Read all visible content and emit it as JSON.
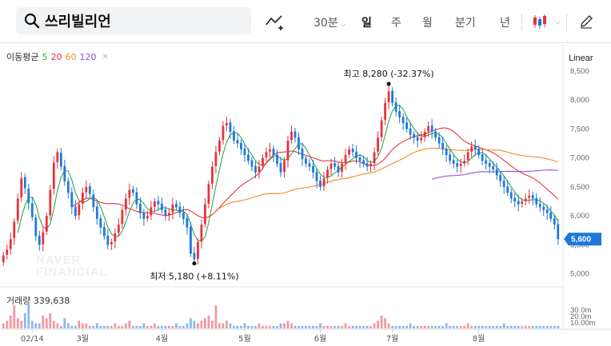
{
  "search": {
    "value": "쓰리빌리언"
  },
  "toolbar": {
    "interval_30m": "30분",
    "periods": [
      "일",
      "주",
      "월",
      "분기",
      "년"
    ],
    "active_period": "일"
  },
  "legend": {
    "label": "이동평균",
    "ma": [
      {
        "period": "5",
        "color": "#2fa84f"
      },
      {
        "period": "20",
        "color": "#e5363b"
      },
      {
        "period": "60",
        "color": "#f08a24"
      },
      {
        "period": "120",
        "color": "#9b4fd1"
      }
    ]
  },
  "scale_mode": "Linear",
  "volume": {
    "label": "거래량",
    "value": "339,638"
  },
  "colors": {
    "up": "#e8313b",
    "down": "#1e78d9",
    "current": "#1e78d9"
  },
  "chart_data": {
    "type": "candlestick",
    "y_ticks": [
      "8,500",
      "8,000",
      "7,500",
      "7,000",
      "6,500",
      "6,000",
      "5,500",
      "5,000"
    ],
    "ylim": [
      4900,
      8650
    ],
    "x_labels": [
      "02/14",
      "3월",
      "4월",
      "5월",
      "6월",
      "7월",
      "8월"
    ],
    "volume_ticks": [
      "30.0m",
      "20.0m",
      "10.00m"
    ],
    "current_price": "5,600",
    "high_annotation": {
      "label": "최고 8,280 (-32.37%)",
      "value": 8280
    },
    "low_annotation": {
      "label": "최저 5,180 (+8.11%)",
      "value": 5180
    },
    "watermark": [
      "NAVER",
      "FINANCIAL"
    ],
    "closes": [
      5320,
      5420,
      5600,
      5900,
      6300,
      6650,
      6480,
      6220,
      5980,
      5650,
      5500,
      5720,
      6000,
      6450,
      6920,
      7100,
      6850,
      6600,
      6400,
      6150,
      6000,
      6200,
      6400,
      6500,
      6380,
      6150,
      5950,
      5800,
      5650,
      5500,
      5550,
      5700,
      5850,
      6100,
      6300,
      6450,
      6400,
      6200,
      6050,
      5950,
      6000,
      6150,
      6250,
      6200,
      6100,
      6000,
      6050,
      6200,
      6150,
      6050,
      5950,
      5800,
      5350,
      5250,
      5550,
      5850,
      6200,
      6550,
      6850,
      7100,
      7300,
      7550,
      7600,
      7450,
      7300,
      7250,
      7150,
      7050,
      6950,
      6850,
      6750,
      6850,
      7000,
      7100,
      7150,
      7050,
      6900,
      6750,
      6950,
      7300,
      7450,
      7350,
      7150,
      6980,
      6900,
      6850,
      6750,
      6600,
      6500,
      6650,
      6800,
      6900,
      6850,
      6750,
      6900,
      7050,
      7150,
      7100,
      7000,
      6950,
      6900,
      6850,
      6900,
      7100,
      7350,
      7650,
      7950,
      8150,
      7950,
      7800,
      7700,
      7600,
      7500,
      7400,
      7350,
      7300,
      7350,
      7450,
      7550,
      7450,
      7350,
      7250,
      7150,
      7050,
      6950,
      6900,
      6850,
      6900,
      6950,
      7100,
      7200,
      7150,
      7050,
      6950,
      6900,
      6850,
      6800,
      6700,
      6600,
      6500,
      6400,
      6300,
      6250,
      6200,
      6250,
      6300,
      6350,
      6300,
      6200,
      6150,
      6100,
      6050,
      5950,
      5850,
      5600
    ],
    "opens": [
      5200,
      5330,
      5430,
      5620,
      5920,
      6320,
      6670,
      6470,
      6220,
      5970,
      5660,
      5510,
      5730,
      6010,
      6470,
      6930,
      7090,
      6860,
      6600,
      6410,
      6160,
      6010,
      6210,
      6410,
      6510,
      6370,
      6160,
      5960,
      5810,
      5660,
      5510,
      5560,
      5710,
      5860,
      6110,
      6310,
      6460,
      6410,
      6210,
      6060,
      5960,
      6010,
      6160,
      6260,
      6210,
      6110,
      6010,
      6060,
      6210,
      6160,
      6060,
      5960,
      5810,
      5360,
      5260,
      5560,
      5860,
      6210,
      6560,
      6860,
      7110,
      7310,
      7560,
      7610,
      7460,
      7310,
      7260,
      7160,
      7060,
      6960,
      6860,
      6760,
      6860,
      7010,
      7110,
      7160,
      7060,
      6910,
      6760,
      6960,
      7310,
      7460,
      7360,
      7160,
      6990,
      6910,
      6860,
      6760,
      6610,
      6510,
      6660,
      6810,
      6910,
      6860,
      6760,
      6910,
      7060,
      7160,
      7110,
      7010,
      6960,
      6910,
      6860,
      6910,
      7110,
      7360,
      7660,
      7960,
      8160,
      7960,
      7810,
      7710,
      7610,
      7510,
      7410,
      7360,
      7310,
      7360,
      7460,
      7560,
      7460,
      7360,
      7260,
      7160,
      7060,
      6960,
      6910,
      6860,
      6910,
      6960,
      7110,
      7210,
      7160,
      7060,
      6960,
      6910,
      6860,
      6810,
      6710,
      6610,
      6510,
      6410,
      6310,
      6260,
      6210,
      6260,
      6310,
      6360,
      6310,
      6210,
      6160,
      6110,
      6060,
      5960,
      5860
    ],
    "volumes": [
      2,
      3,
      5,
      9,
      4,
      3,
      6,
      10,
      3,
      2,
      2,
      5,
      4,
      6,
      3,
      2,
      1,
      4,
      2,
      1,
      1,
      3,
      2,
      2,
      1,
      1,
      2,
      1,
      1,
      1,
      1,
      2,
      1,
      1,
      2,
      3,
      1,
      1,
      1,
      2,
      1,
      1,
      2,
      1,
      1,
      1,
      1,
      1,
      2,
      1,
      1,
      2,
      4,
      3,
      2,
      3,
      4,
      5,
      3,
      9,
      2,
      2,
      3,
      2,
      1,
      1,
      1,
      2,
      1,
      1,
      1,
      2,
      1,
      1,
      1,
      1,
      1,
      2,
      2,
      3,
      2,
      1,
      1,
      1,
      1,
      1,
      1,
      1,
      2,
      1,
      1,
      1,
      1,
      1,
      1,
      2,
      1,
      1,
      1,
      1,
      1,
      1,
      1,
      2,
      3,
      5,
      4,
      2,
      1,
      1,
      1,
      1,
      1,
      2,
      1,
      1,
      1,
      1,
      1,
      1,
      1,
      1,
      1,
      2,
      1,
      1,
      1,
      1,
      1,
      2,
      1,
      1,
      1,
      1,
      1,
      1,
      1,
      1,
      1,
      2,
      1,
      1,
      1,
      1,
      1,
      1,
      1,
      1,
      1,
      1,
      1,
      1,
      1,
      1,
      1
    ]
  }
}
